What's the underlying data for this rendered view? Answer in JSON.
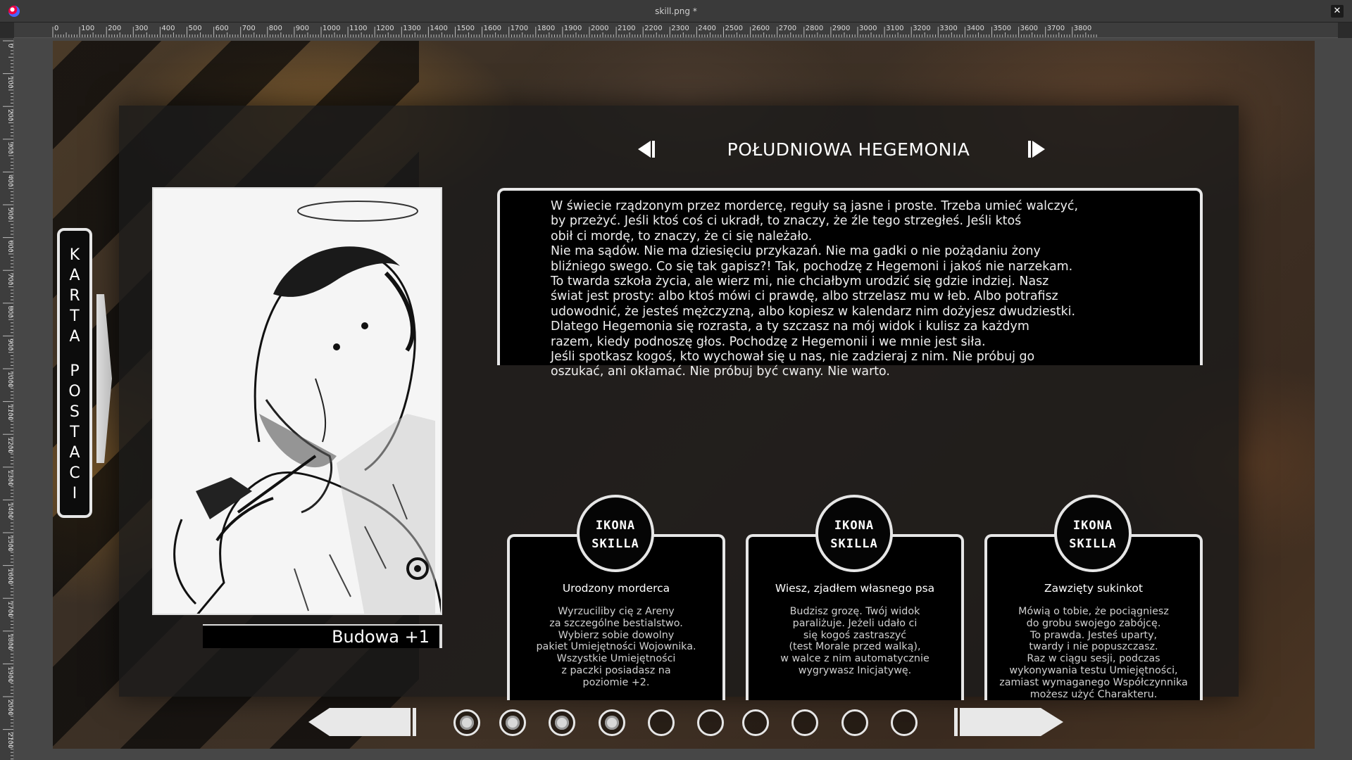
{
  "window": {
    "title": "skill.png *",
    "close_label": "✕"
  },
  "ruler": {
    "h_ticks": [
      "0",
      "100",
      "200",
      "300",
      "400",
      "500",
      "600",
      "700",
      "800",
      "900",
      "1000",
      "1100",
      "1200",
      "1300",
      "1400",
      "1500",
      "1600",
      "1700",
      "1800",
      "1900",
      "2000",
      "2100",
      "2200",
      "2300",
      "2400",
      "2500",
      "2600",
      "2700",
      "2800",
      "2900",
      "3000",
      "3100",
      "3200",
      "3300",
      "3400",
      "3500",
      "3600",
      "3700",
      "3800"
    ],
    "v_ticks": [
      "0",
      "100",
      "200",
      "300",
      "400",
      "500",
      "600",
      "700",
      "800",
      "900",
      "1000",
      "1100",
      "1200",
      "1300",
      "1400",
      "1500",
      "1600",
      "1700",
      "1800",
      "1900",
      "2000",
      "2100"
    ]
  },
  "sidetab": {
    "letters_1": [
      "K",
      "A",
      "R",
      "T",
      "A"
    ],
    "letters_2": [
      "P",
      "O",
      "S",
      "T",
      "A",
      "C",
      "I"
    ]
  },
  "header": {
    "faction": "POŁUDNIOWA HEGEMONIA"
  },
  "portrait": {
    "stat": "Budowa +1"
  },
  "description": "W świecie rządzonym przez mordercę, reguły są jasne i proste. Trzeba umieć walczyć,\nby przeżyć. Jeśli ktoś coś ci ukradł, to znaczy, że źle tego strzegłeś. Jeśli ktoś\nobił ci mordę, to znaczy, że ci się należało.\nNie ma sądów. Nie ma dziesięciu przykazań. Nie ma gadki o nie pożądaniu żony\nbliźniego swego. Co się tak gapisz?! Tak, pochodzę z Hegemoni i jakoś nie narzekam.\nTo twarda szkoła życia, ale wierz mi, nie chciałbym urodzić się gdzie indziej. Nasz\nświat jest prosty: albo ktoś mówi ci prawdę, albo strzelasz mu w łeb. Albo potrafisz\nudowodnić, że jesteś mężczyzną, albo kopiesz w kalendarz nim dożyjesz dwudziestki.\nDlatego Hegemonia się rozrasta, a ty szczasz na mój widok i kulisz za każdym\nrazem, kiedy podnoszę głos. Pochodzę z Hegemonii i we mnie jest siła.\nJeśli spotkasz kogoś, kto wychował się u nas, nie zadzieraj z nim. Nie próbuj go\noszukać, ani okłamać. Nie próbuj być cwany. Nie warto.",
  "skills": [
    {
      "icon": "IKONA\nSKILLA",
      "name": "Urodzony morderca",
      "text": "Wyrzuciliby cię z Areny\nza szczególne bestialstwo.\nWybierz sobie dowolny\npakiet Umiejętności Wojownika.\nWszystkie Umiejętności\nz paczki posiadasz na\npoziomie +2."
    },
    {
      "icon": "IKONA\nSKILLA",
      "name": "Wiesz, zjadłem własnego psa",
      "text": "Budzisz grozę. Twój widok\nparaliżuje. Jeżeli udało ci\nsię kogoś zastraszyć\n(test Morale przed walką),\nw walce z nim automatycznie\nwygrywasz Inicjatywę."
    },
    {
      "icon": "IKONA\nSKILLA",
      "name": "Zawzięty sukinkot",
      "text": "Mówią o tobie, że pociągniesz\ndo grobu swojego zabójcę.\nTo prawda. Jesteś uparty,\ntwardy i nie popuszczasz.\nRaz w ciągu sesji, podczas\nwykonywania testu Umiejętności,\nzamiast wymaganego Współczynnika\nmożesz użyć Charakteru."
    }
  ],
  "pager": {
    "total": 10,
    "filled": 4
  },
  "colors": {
    "frame": "#e6e6e6",
    "panel": "#191919",
    "text": "#ffffff"
  }
}
